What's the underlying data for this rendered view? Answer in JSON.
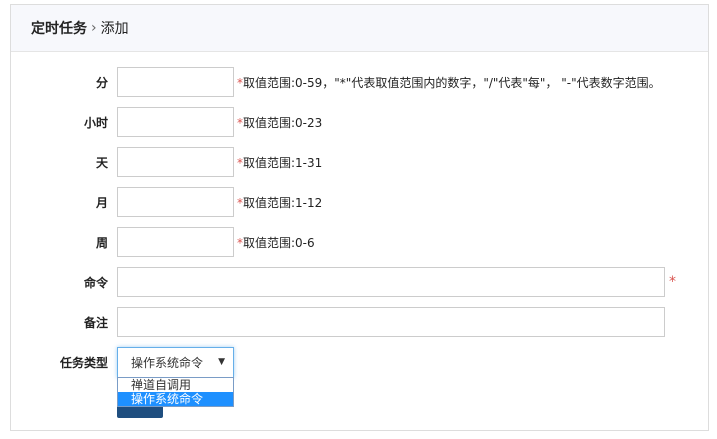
{
  "breadcrumb": {
    "parent": "定时任务",
    "separator": "›",
    "current": "添加"
  },
  "fields": [
    {
      "label": "分",
      "hint": "取值范围:0-59，\"*\"代表取值范围内的数字，\"/\"代表\"每\"， \"-\"代表数字范围。"
    },
    {
      "label": "小时",
      "hint": "取值范围:0-23"
    },
    {
      "label": "天",
      "hint": "取值范围:1-31"
    },
    {
      "label": "月",
      "hint": "取值范围:1-12"
    },
    {
      "label": "周",
      "hint": "取值范围:0-6"
    }
  ],
  "command": {
    "label": "命令",
    "required": "*"
  },
  "note": {
    "label": "备注"
  },
  "task_type": {
    "label": "任务类型",
    "selected": "操作系统命令",
    "options": [
      "禅道自调用",
      "操作系统命令"
    ]
  },
  "star": "*"
}
